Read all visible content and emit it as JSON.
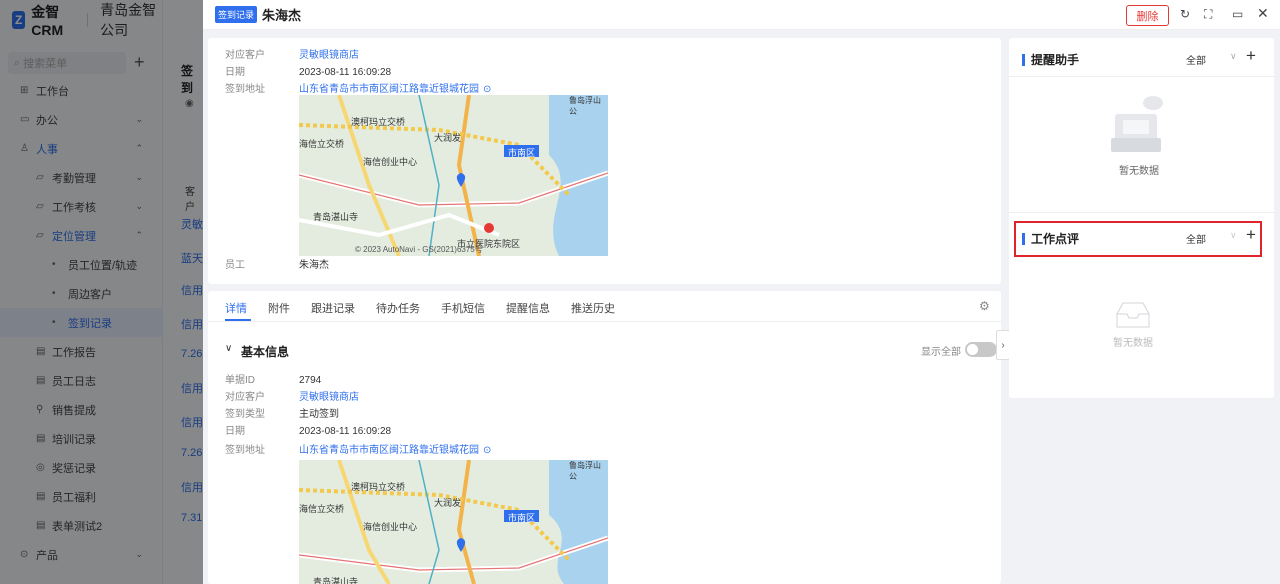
{
  "app": {
    "product": "金智CRM",
    "company": "青岛金智公司",
    "search_placeholder": "搜索菜单"
  },
  "sidebar": {
    "items": [
      {
        "label": "工作台",
        "icon": "grid-icon"
      },
      {
        "label": "办公",
        "icon": "briefcase-icon"
      },
      {
        "label": "人事",
        "icon": "people-icon"
      },
      {
        "label": "考勤管理"
      },
      {
        "label": "工作考核"
      },
      {
        "label": "定位管理"
      },
      {
        "label": "员工位置/轨迹"
      },
      {
        "label": "周边客户"
      },
      {
        "label": "签到记录"
      },
      {
        "label": "工作报告"
      },
      {
        "label": "员工日志"
      },
      {
        "label": "销售提成"
      },
      {
        "label": "培训记录"
      },
      {
        "label": "奖惩记录"
      },
      {
        "label": "员工福利"
      },
      {
        "label": "表单测试2"
      },
      {
        "label": "产品"
      }
    ]
  },
  "background_list": {
    "header": "签到",
    "col": "客户",
    "cells": [
      "灵敏",
      "蓝天",
      "信用",
      "信用",
      "7.26",
      "信用",
      "信用",
      "7.26",
      "信用",
      "7.31"
    ]
  },
  "drawer": {
    "tag": "签到记录",
    "title": "朱海杰",
    "delete_label": "删除",
    "top_card": {
      "customer_label": "对应客户",
      "customer": "灵敏眼镜商店",
      "date_label": "日期",
      "date": "2023-08-11 16:09:28",
      "address_label": "签到地址",
      "address": "山东省青岛市市南区闽江路靠近银城花园",
      "employee_label": "员工",
      "employee": "朱海杰"
    },
    "map": {
      "labels": [
        "澳柯玛立交桥",
        "大润发",
        "海信立交桥",
        "海信创业中心",
        "市南区",
        "青岛湛山寺",
        "市立医院东院区",
        "鲁岛浮山公"
      ],
      "copyright": "© 2023 AutoNavi - GS(2021)6375号"
    },
    "tabs": [
      "详情",
      "附件",
      "跟进记录",
      "待办任务",
      "手机短信",
      "提醒信息",
      "推送历史"
    ],
    "section_title": "基本信息",
    "show_all": "显示全部",
    "detail": {
      "id_label": "单据ID",
      "id": "2794",
      "customer_label": "对应客户",
      "customer": "灵敏眼镜商店",
      "type_label": "签到类型",
      "type": "主动签到",
      "date_label": "日期",
      "date": "2023-08-11 16:09:28",
      "address_label": "签到地址",
      "address": "山东省青岛市市南区闽江路靠近银城花园"
    }
  },
  "right_panel": {
    "reminder_title": "提醒助手",
    "reminder_filter": "全部",
    "reminder_empty": "暂无数据",
    "review_title": "工作点评",
    "review_filter": "全部",
    "review_empty": "暂无数据"
  }
}
